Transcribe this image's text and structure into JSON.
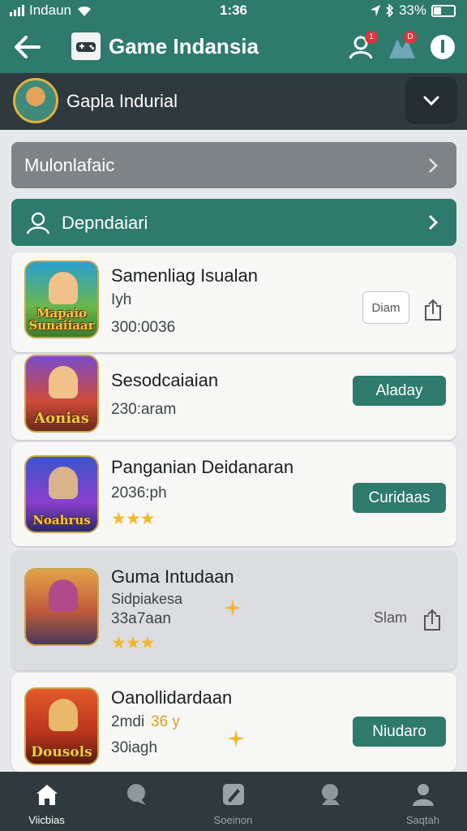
{
  "status_bar": {
    "carrier": "Indaun",
    "time": "1:36",
    "battery": "33%"
  },
  "app_bar": {
    "title": "Game Indansia",
    "notification_badge_1": "1",
    "notification_badge_2": "D"
  },
  "profile": {
    "name": "Gapla Indurial"
  },
  "section_gray": {
    "label": "Mulonlafaic"
  },
  "section_green": {
    "label": "Depndaiari"
  },
  "games": [
    {
      "title": "Samenliag Isualan",
      "subtitle": "Iyh",
      "meta": "300:0036",
      "thumb_text": "Mapaio Sunaiiaar",
      "action_label": "Diam"
    },
    {
      "title": "Sesodcaiaian",
      "meta": "230:aram",
      "thumb_text": "Aonias",
      "action_label": "Aladay"
    },
    {
      "title": "Panganian Deidanaran",
      "meta": "2036:ph",
      "thumb_text": "Noahrus",
      "action_label": "Curidaas",
      "stars": "★★★"
    },
    {
      "title": "Guma Intudaan",
      "subtitle": "Sidpiakesa",
      "meta": "33a7aan",
      "stars": "★★★",
      "action_label": "Slam"
    },
    {
      "title": "Oanollidardaan",
      "subtitle": "2mdi",
      "subtitle_extra": "36 y",
      "meta": "30iagh",
      "thumb_text": "Dousols",
      "action_label": "Niudaro"
    }
  ],
  "bottom_nav": [
    {
      "label": "Viicbias"
    },
    {
      "label": ""
    },
    {
      "label": "Soeinon"
    },
    {
      "label": ""
    },
    {
      "label": "Saqtah"
    }
  ],
  "colors": {
    "primary": "#2e7a6c",
    "dark": "#2f3a3f",
    "star": "#f2b82c"
  }
}
